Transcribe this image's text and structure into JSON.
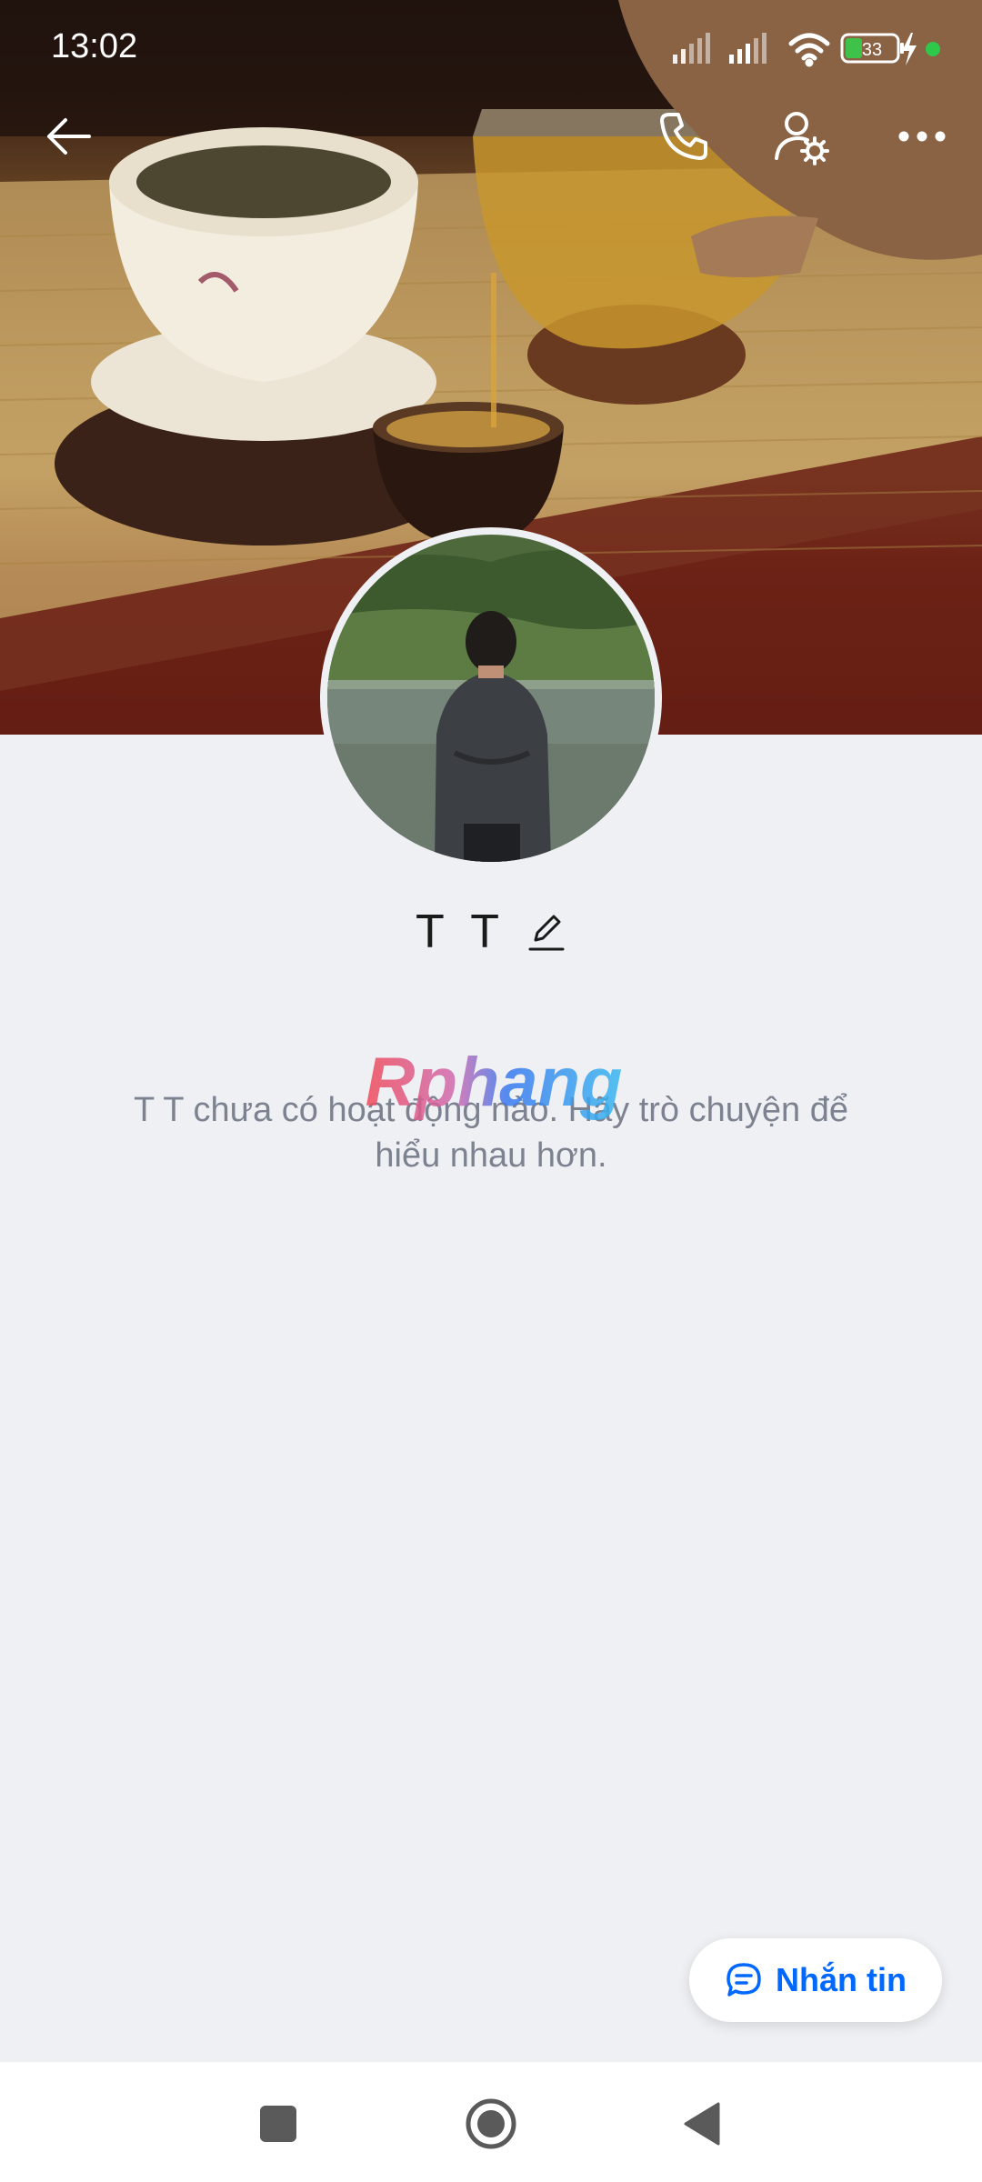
{
  "status_bar": {
    "time": "13:02",
    "battery_level": "33",
    "icons": [
      "signal-icon",
      "signal-icon",
      "wifi-icon",
      "battery-icon",
      "charging-icon",
      "notification-dot-icon"
    ]
  },
  "top_nav": {
    "back_icon": "arrow-left-icon",
    "call_icon": "phone-icon",
    "profile_settings_icon": "user-gear-icon",
    "more_icon": "more-horizontal-icon"
  },
  "profile": {
    "name": "T T",
    "edit_icon": "pencil-icon"
  },
  "empty_state": {
    "message": "T T chưa có hoạt động nào. Hãy trò chuyện để hiểu nhau hơn."
  },
  "watermark": {
    "text": "Rphang"
  },
  "message_button": {
    "label": "Nhắn tin",
    "icon": "chat-bubble-icon"
  },
  "system_nav": {
    "recent_icon": "square-icon",
    "home_icon": "circle-icon",
    "back_icon": "triangle-back-icon"
  },
  "colors": {
    "accent": "#0068ff",
    "background": "#eff0f4",
    "text_primary": "#1a1a1a",
    "text_secondary": "#7c8290"
  }
}
